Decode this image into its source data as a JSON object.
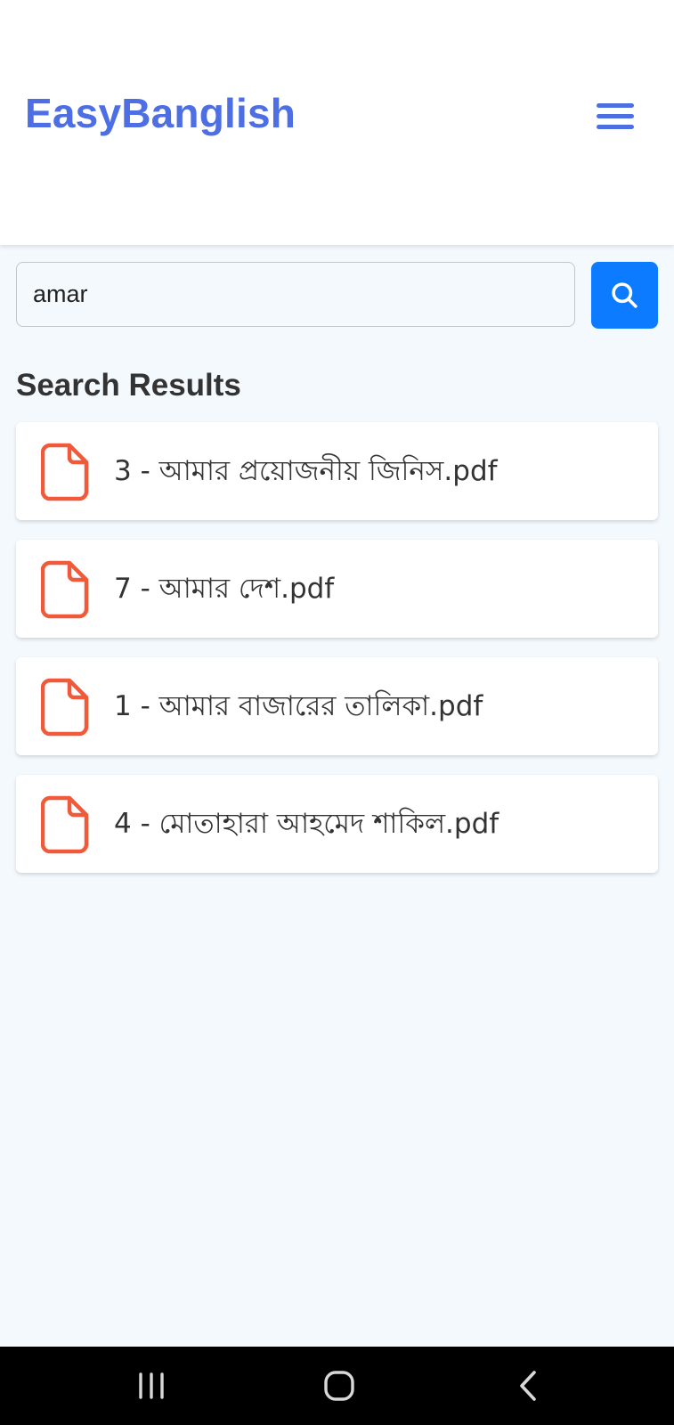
{
  "header": {
    "brand": "EasyBanglish",
    "menu_icon": "hamburger-menu-icon"
  },
  "search": {
    "value": "amar",
    "button_icon": "search-icon"
  },
  "results": {
    "title": "Search Results",
    "items": [
      {
        "label": "3 - আমার প্রয়োজনীয় জিনিস.pdf",
        "icon": "file-icon"
      },
      {
        "label": "7 - আমার দেশ.pdf",
        "icon": "file-icon"
      },
      {
        "label": "1 - আমার বাজারের তালিকা.pdf",
        "icon": "file-icon"
      },
      {
        "label": "4 - মোতাহারা আহমেদ শাকিল.pdf",
        "icon": "file-icon"
      }
    ]
  },
  "system_nav": {
    "buttons": [
      "recent-apps-icon",
      "home-icon",
      "back-icon"
    ]
  },
  "colors": {
    "brand": "#4e6fe4",
    "search_button": "#0d7bff",
    "file_icon": "#f05a3a",
    "background": "#f4f9fd"
  }
}
